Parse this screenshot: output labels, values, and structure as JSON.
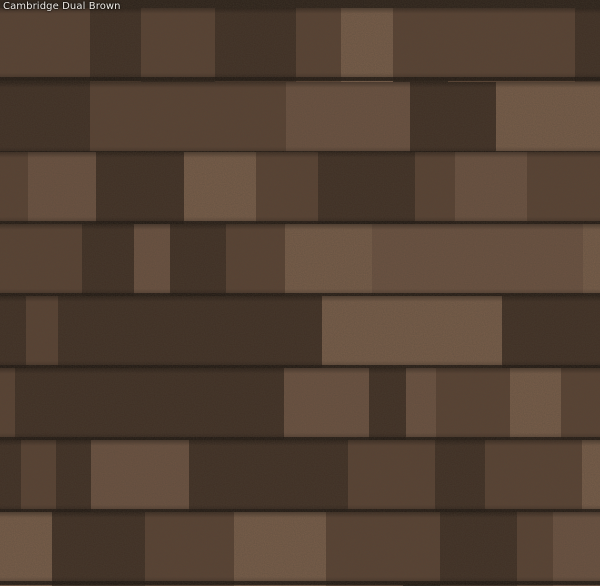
{
  "caption": "Cambridge Dual Brown",
  "colors": {
    "dark": "#3f2f24",
    "mid": "#5a4334",
    "light": "#6e5443",
    "lighter": "#7a5f4b",
    "shadow": "#1c1510"
  }
}
